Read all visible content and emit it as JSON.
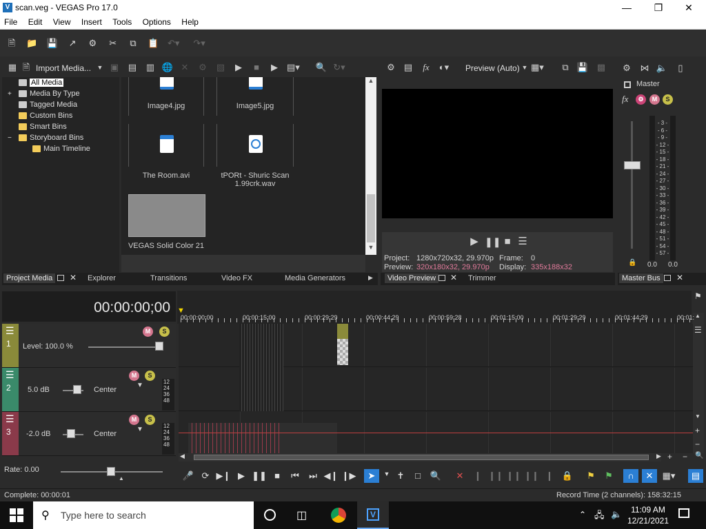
{
  "window": {
    "title": "scan.veg - VEGAS Pro 17.0",
    "controls": [
      "minimize",
      "maximize",
      "close"
    ]
  },
  "menu": [
    "File",
    "Edit",
    "View",
    "Insert",
    "Tools",
    "Options",
    "Help"
  ],
  "media_panel": {
    "toolbar_label": "Import Media...",
    "tree": [
      {
        "label": "All Media",
        "selected": true,
        "expander": ""
      },
      {
        "label": "Media By Type",
        "expander": "+"
      },
      {
        "label": "Tagged Media",
        "expander": ""
      },
      {
        "label": "Custom Bins",
        "expander": ""
      },
      {
        "label": "Smart Bins",
        "expander": ""
      },
      {
        "label": "Storyboard Bins",
        "expander": "−"
      },
      {
        "label": "Main Timeline",
        "expander": ""
      }
    ],
    "items": [
      {
        "label": "Image4.jpg"
      },
      {
        "label": "Image5.jpg"
      },
      {
        "label": "The Room.avi"
      },
      {
        "label": "tPORt - Shuric Scan 1.99crk.wav"
      },
      {
        "label": "VEGAS Solid Color 21"
      }
    ],
    "tabs": [
      "Project Media",
      "Explorer",
      "Transitions",
      "Video FX",
      "Media Generators"
    ]
  },
  "preview_panel": {
    "mode": "Preview (Auto)",
    "project_label": "Project:",
    "project_value": "1280x720x32, 29.970p",
    "preview_label": "Preview:",
    "preview_value": "320x180x32, 29.970p",
    "frame_label": "Frame:",
    "frame_value": "0",
    "display_label": "Display:",
    "display_value": "335x188x32",
    "tabs": [
      "Video Preview",
      "Trimmer"
    ]
  },
  "master_panel": {
    "label": "Master",
    "scale": [
      "3",
      "6",
      "9",
      "12",
      "15",
      "18",
      "21",
      "24",
      "27",
      "30",
      "33",
      "36",
      "39",
      "42",
      "45",
      "48",
      "51",
      "54",
      "57"
    ],
    "left_value": "0.0",
    "right_value": "0.0",
    "tab": "Master Bus"
  },
  "timeline": {
    "time": "00:00:00;00",
    "ruler": [
      "00:00:00;00",
      "00:00:15;00",
      "00:00:29;29",
      "00:00:44;29",
      "00:00:59;28",
      "00:01:15;00",
      "00:01:29;29",
      "00:01:44;29",
      "00:01:"
    ],
    "tracks": [
      {
        "number": "1",
        "param": "Level: 100.0 %",
        "pan": "",
        "color": "#8a8a3a"
      },
      {
        "number": "2",
        "param": "5.0 dB",
        "pan": "Center",
        "color": "#3a8a6a"
      },
      {
        "number": "3",
        "param": "-2.0 dB",
        "pan": "Center",
        "color": "#8a3a4a"
      }
    ],
    "meter_ticks": [
      "12",
      "24",
      "36",
      "48"
    ],
    "rate": "Rate: 0.00"
  },
  "status": {
    "left": "Complete: 00:00:01",
    "right": "Record Time (2 channels): 158:32:15"
  },
  "taskbar": {
    "search_placeholder": "Type here to search",
    "time": "11:09 AM",
    "date": "12/21/2021"
  }
}
